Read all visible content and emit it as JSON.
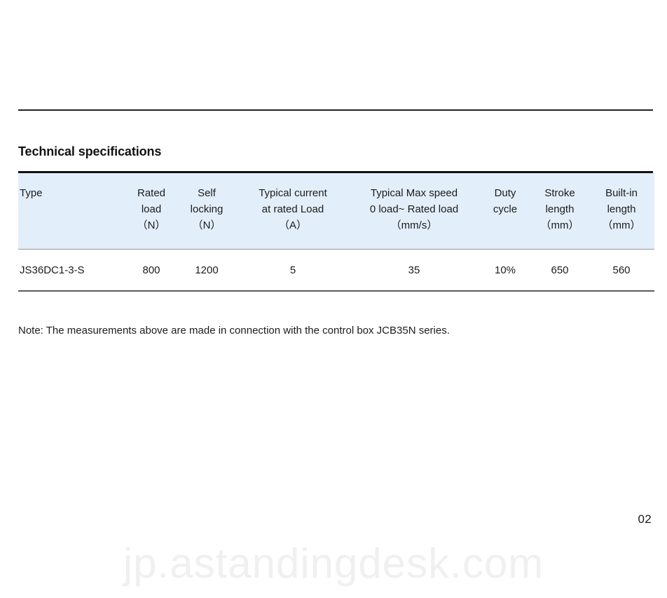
{
  "document": {
    "section_title": "Technical specifications",
    "note": "Note: The measurements above are made in connection with the control box JCB35N series.",
    "page_number": "02",
    "watermark": "jp.astandingdesk.com",
    "accent_header_color": "#e2eef9",
    "rule_color": "#111111"
  },
  "table": {
    "headers": [
      {
        "line1": "Type",
        "line2": "",
        "line3": ""
      },
      {
        "line1": "Rated",
        "line2": "load",
        "line3": "（N）"
      },
      {
        "line1": "Self",
        "line2": "locking",
        "line3": "（N）"
      },
      {
        "line1": "Typical current",
        "line2": "at rated Load",
        "line3": "（A）"
      },
      {
        "line1": "Typical Max speed",
        "line2": "0 load~ Rated load",
        "line3": "（mm/s）"
      },
      {
        "line1": "Duty",
        "line2": "cycle",
        "line3": ""
      },
      {
        "line1": "Stroke",
        "line2": "length",
        "line3": "（mm）"
      },
      {
        "line1": "Built-in",
        "line2": "length",
        "line3": "（mm）"
      }
    ],
    "rows": [
      {
        "type": "JS36DC1-3-S",
        "rated_load": "800",
        "self_locking": "1200",
        "typical_current": "5",
        "typical_max_speed": "35",
        "duty_cycle": "10%",
        "stroke_length": "650",
        "builtin_length": "560"
      }
    ]
  }
}
